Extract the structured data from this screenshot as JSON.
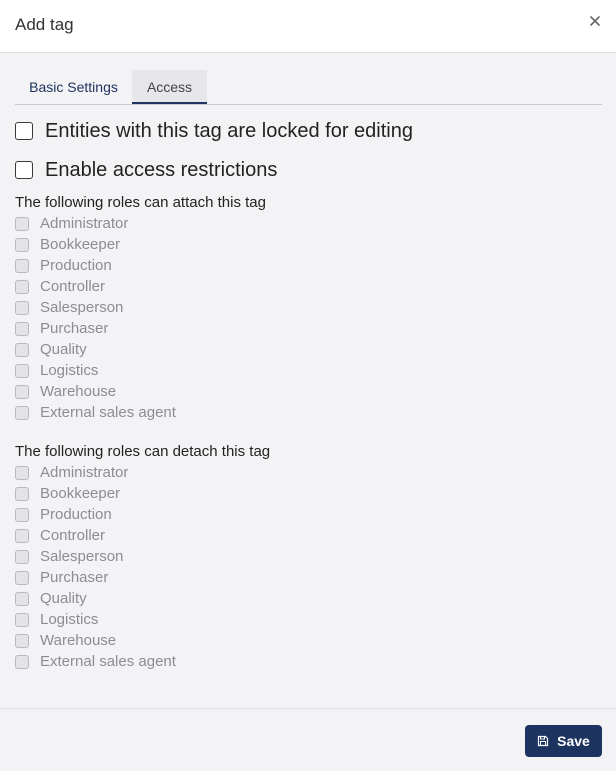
{
  "dialog": {
    "title": "Add tag",
    "close_icon": "close-icon"
  },
  "tabs": [
    {
      "label": "Basic Settings",
      "active": false
    },
    {
      "label": "Access",
      "active": true
    }
  ],
  "options": {
    "locked_label": "Entities with this tag are locked for editing",
    "locked_checked": false,
    "restrict_label": "Enable access restrictions",
    "restrict_checked": false
  },
  "attach": {
    "heading": "The following roles can attach this tag",
    "roles": [
      "Administrator",
      "Bookkeeper",
      "Production",
      "Controller",
      "Salesperson",
      "Purchaser",
      "Quality",
      "Logistics",
      "Warehouse",
      "External sales agent"
    ]
  },
  "detach": {
    "heading": "The following roles can detach this tag",
    "roles": [
      "Administrator",
      "Bookkeeper",
      "Production",
      "Controller",
      "Salesperson",
      "Purchaser",
      "Quality",
      "Logistics",
      "Warehouse",
      "External sales agent"
    ]
  },
  "footer": {
    "save_label": "Save",
    "save_icon": "floppy-disk-icon"
  },
  "colors": {
    "accent": "#1d3461",
    "background": "#f3f3f6",
    "disabled_text": "#8c8c94"
  }
}
